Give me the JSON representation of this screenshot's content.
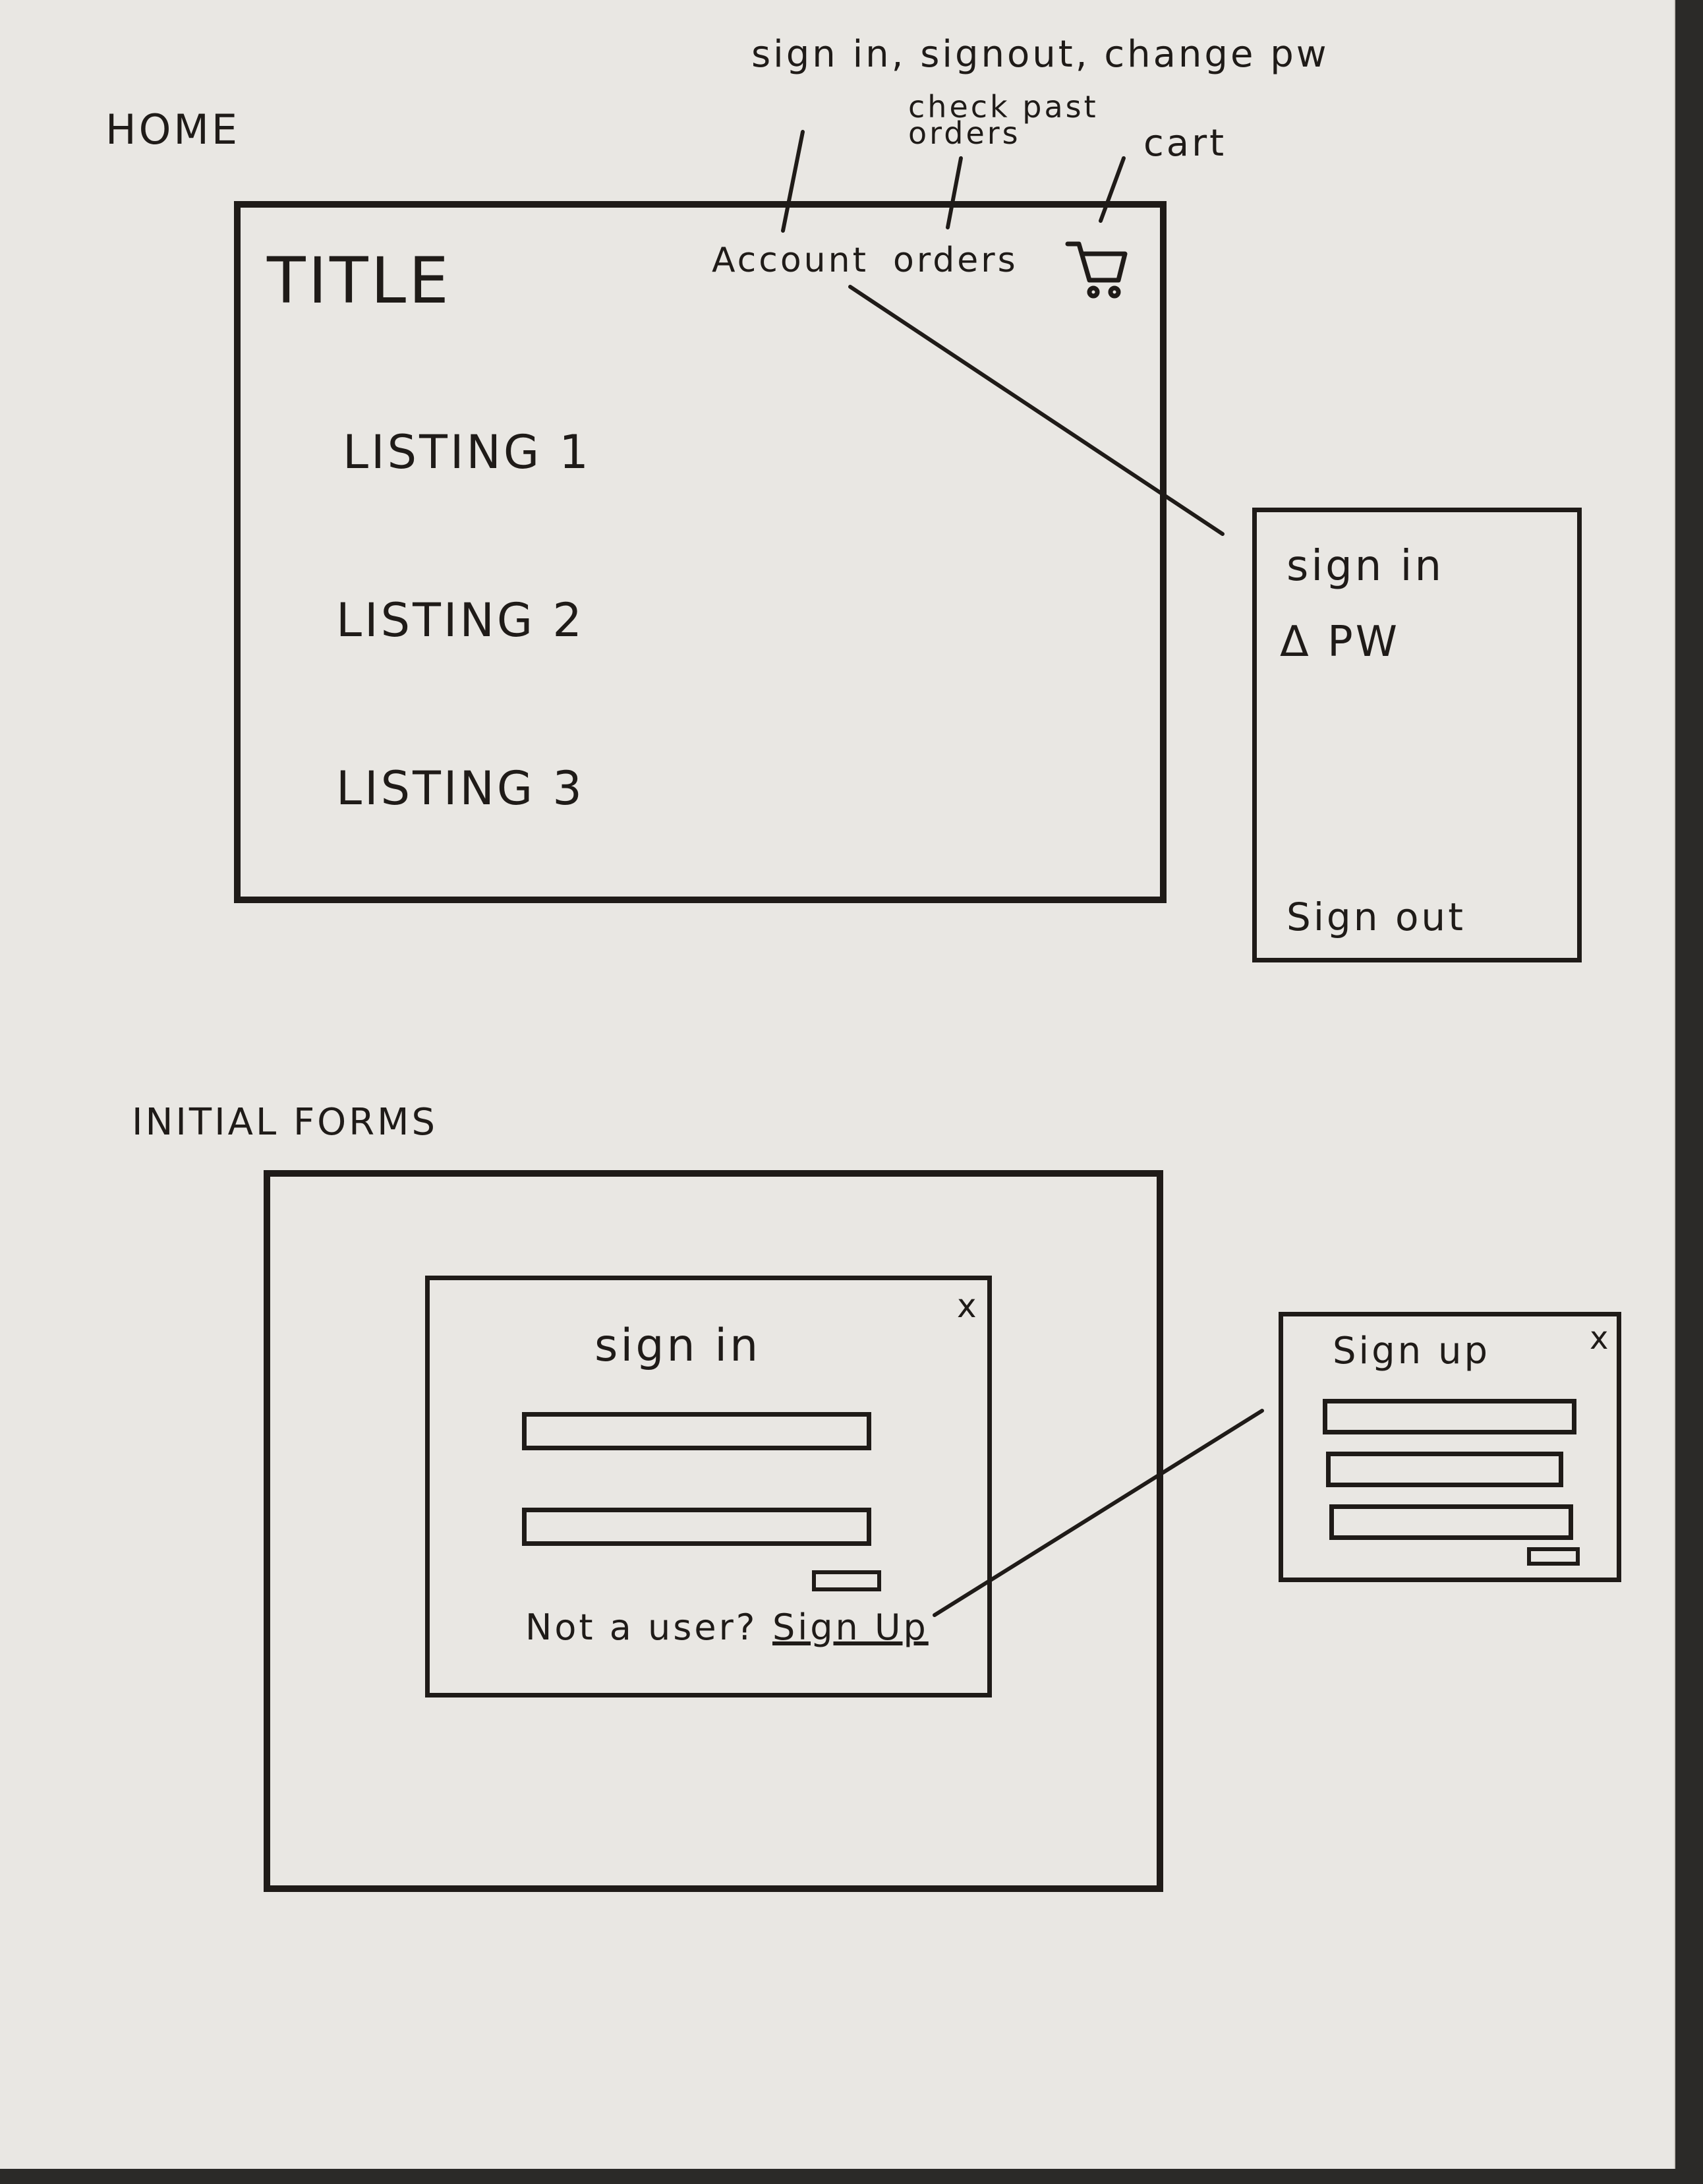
{
  "home": {
    "section_label": "HOME",
    "title": "TITLE",
    "nav": {
      "account": "Account",
      "orders": "orders",
      "cart_icon": "cart-icon"
    },
    "listings": [
      "LISTING 1",
      "LISTING 2",
      "LISTING 3"
    ],
    "annotations": {
      "account": "sign in, signout, change pw",
      "orders": "check past orders",
      "cart": "cart"
    },
    "account_menu": {
      "sign_in": "sign in",
      "change_pw": "Δ PW",
      "sign_out": "Sign out"
    }
  },
  "forms": {
    "section_label": "INITIAL FORMS",
    "sign_in_modal": {
      "title": "sign in",
      "close": "x",
      "prompt": "Not a user?",
      "sign_up_link": "Sign Up"
    },
    "sign_up_modal": {
      "title": "Sign up",
      "close": "x"
    }
  }
}
